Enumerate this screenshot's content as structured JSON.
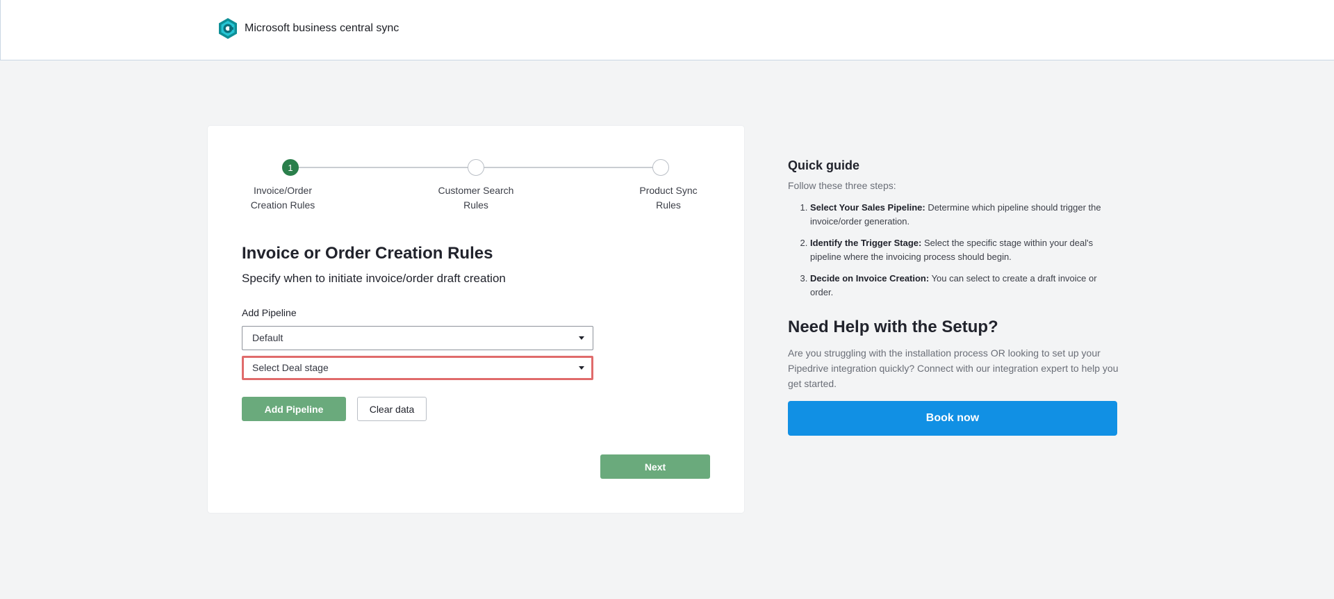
{
  "header": {
    "app_name": "Microsoft business central sync",
    "logo_icon": "business-central-logo-icon"
  },
  "stepper": {
    "steps": [
      {
        "number": "1",
        "line1": "Invoice/Order",
        "line2": "Creation Rules",
        "active": true
      },
      {
        "number": "",
        "line1": "Customer Search",
        "line2": "Rules",
        "active": false
      },
      {
        "number": "",
        "line1": "Product Sync",
        "line2": "Rules",
        "active": false
      }
    ]
  },
  "form": {
    "title": "Invoice or Order Creation Rules",
    "subtitle": "Specify when to initiate invoice/order draft creation",
    "pipeline_label": "Add Pipeline",
    "pipeline_value": "Default",
    "deal_stage_placeholder": "Select Deal stage",
    "add_pipeline_label": "Add Pipeline",
    "clear_label": "Clear data",
    "next_label": "Next"
  },
  "guide": {
    "title": "Quick guide",
    "intro": "Follow these three steps:",
    "steps": [
      {
        "bold": "Select Your Sales Pipeline:",
        "text": " Determine which pipeline should trigger the invoice/order generation."
      },
      {
        "bold": "Identify the Trigger Stage:",
        "text": " Select the specific stage within your deal's pipeline where the invoicing process should begin."
      },
      {
        "bold": "Decide on Invoice Creation:",
        "text": " You can select to create a draft invoice or order."
      }
    ]
  },
  "help": {
    "title": "Need Help with the Setup?",
    "text": "Are you struggling with the installation process OR looking to set up your Pipedrive integration quickly? Connect with our integration expert to help you get started.",
    "button_label": "Book now"
  },
  "colors": {
    "primary_green": "#2a7f4b",
    "button_green": "#6aaa7c",
    "book_blue": "#1190e4",
    "highlight_red": "#e06b6b",
    "page_bg": "#f3f4f5"
  }
}
